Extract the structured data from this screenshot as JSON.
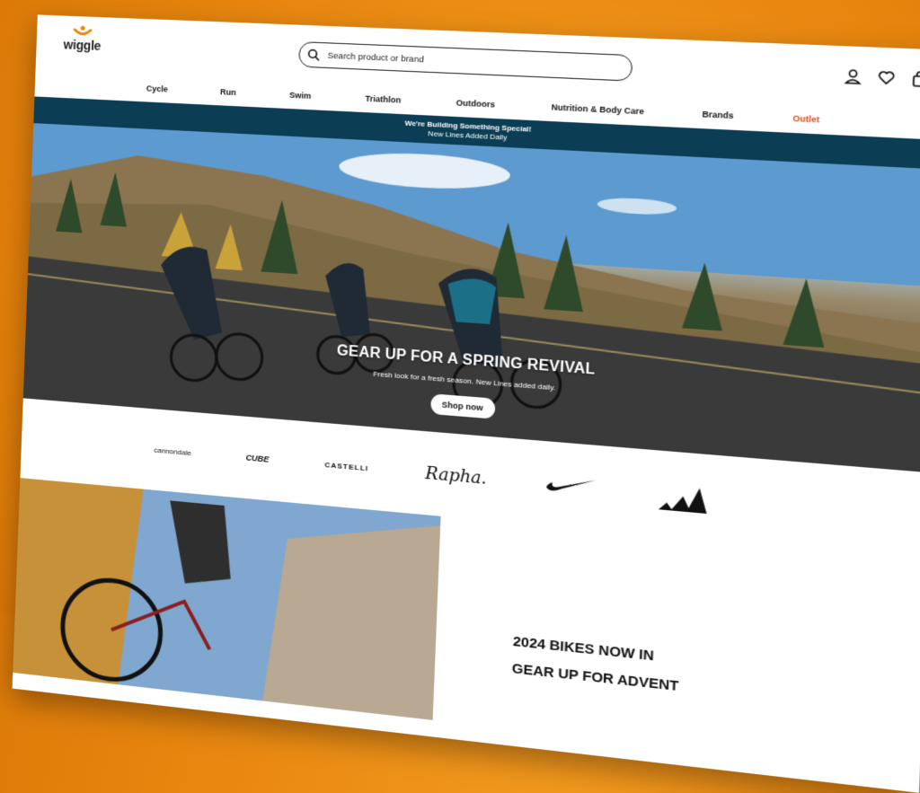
{
  "header": {
    "logo_text": "wiggle",
    "search_placeholder": "Search product or brand",
    "icons": [
      "account-icon",
      "heart-icon",
      "bag-icon"
    ],
    "accent": "#e8860f"
  },
  "nav": {
    "items": [
      "Cycle",
      "Run",
      "Swim",
      "Triathlon",
      "Outdoors",
      "Nutrition & Body Care",
      "Brands",
      "Outlet"
    ]
  },
  "banner": {
    "line1": "We're Building Something Special!",
    "line2": "New Lines Added Daily",
    "color": "#0b3e54"
  },
  "hero": {
    "title": "GEAR UP FOR A SPRING REVIVAL",
    "subtitle": "Fresh look for a fresh season. New Lines added daily.",
    "cta": "Shop now"
  },
  "brands": [
    "cannondale",
    "CUBE",
    "CASTELLI",
    "Rapha.",
    "nike-swoosh",
    "adidas-logo"
  ],
  "promo": {
    "heading": "2024 BIKES NOW IN",
    "subheading": "GEAR UP FOR ADVENT"
  }
}
